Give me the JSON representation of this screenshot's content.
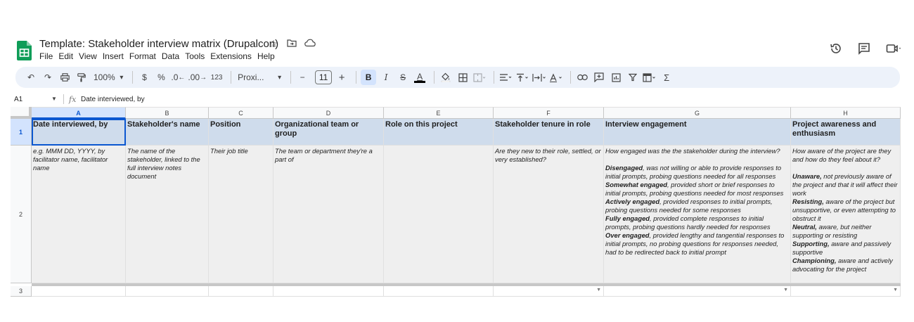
{
  "doc": {
    "title": "Template: Stakeholder interview matrix (Drupalcon)",
    "menu": [
      "File",
      "Edit",
      "View",
      "Insert",
      "Format",
      "Data",
      "Tools",
      "Extensions",
      "Help"
    ]
  },
  "toolbar": {
    "zoom": "100%",
    "currency": "$",
    "percent": "%",
    "dec_decrease": ".0",
    "dec_increase": ".00",
    "number_format": "123",
    "font": "Proxi...",
    "minus": "−",
    "font_size": "11",
    "plus": "+",
    "bold": "B",
    "italic": "I",
    "strike": "S",
    "text_color": "A",
    "sum": "Σ"
  },
  "formula_bar": {
    "cell_ref": "A1",
    "fx": "fx",
    "content": "Date interviewed, by"
  },
  "columns": [
    "A",
    "B",
    "C",
    "D",
    "E",
    "F",
    "G",
    "H"
  ],
  "rows": [
    "1",
    "2",
    "3"
  ],
  "header_row": [
    "Date interviewed, by",
    "Stakeholder's name",
    "Position",
    "Organizational team or group",
    "Role on this project",
    "Stakeholder tenure in role",
    "Interview engagement",
    "Project awareness and enthusiasm"
  ],
  "example_row": {
    "a": "e.g. MMM DD, YYYY, by facilitator name, facilitator name",
    "b": "The name of the stakeholder, linked to the full interview notes document",
    "c": "Their job title",
    "d": "The team or department they're a part of",
    "e": "",
    "f": "Are they new to their role, settled, or very established?",
    "g": {
      "intro": "How engaged was the the stakeholder during the interview?",
      "items": [
        {
          "term": "Disengaged",
          "desc": ", was not willing or able to provide responses to initial prompts, probing questions needed for all responses"
        },
        {
          "term": "Somewhat engaged",
          "desc": ", provided short or brief responses to initial prompts, probing questions needed for most responses"
        },
        {
          "term": "Actively engaged",
          "desc": ", provided responses to initial prompts, probing questions needed for some responses"
        },
        {
          "term": "Fully engaged",
          "desc": ", provided complete responses to initial prompts, probing questions hardly needed for responses"
        },
        {
          "term": "Over engaged",
          "desc": ", provided lengthy and tangential responses to initial prompts, no probing questions for responses needed, had to be redirected back to initial prompt"
        }
      ]
    },
    "h": {
      "intro": "How aware of the project are they and how do they feel about it?",
      "items": [
        {
          "term": "Unaware,",
          "desc": " not previously aware of the project and that it will affect their work"
        },
        {
          "term": "Resisting,",
          "desc": " aware of the project but unsupportive, or even attempting to obstruct it"
        },
        {
          "term": "Neutral,",
          "desc": " aware, but neither supporting or resisting"
        },
        {
          "term": "Supporting,",
          "desc": " aware and passively supportive"
        },
        {
          "term": "Championing,",
          "desc": " aware and actively advocating for the project"
        }
      ]
    }
  },
  "colors": {
    "header_fill": "#cfdcec",
    "example_fill": "#efefef",
    "selection": "#0b57d0",
    "toolbar_bg": "#edf2fa"
  }
}
